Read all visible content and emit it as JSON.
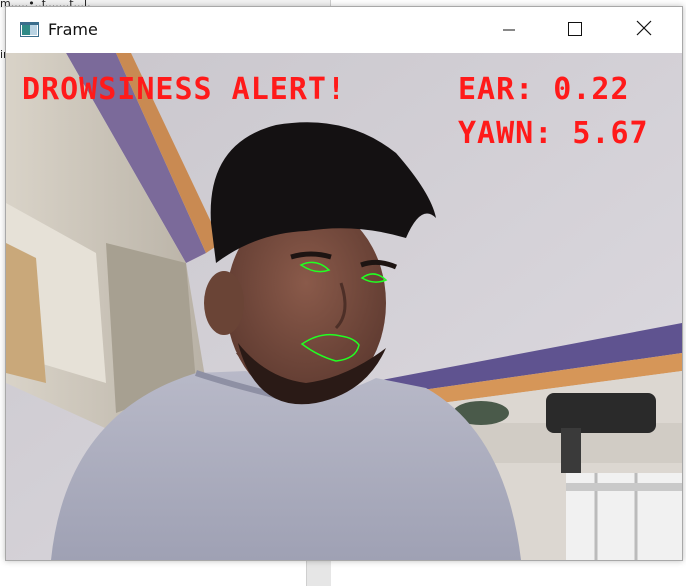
{
  "window": {
    "title": "Frame",
    "icon": "app-window-icon"
  },
  "controls": [
    "minimize-icon",
    "maximize-icon",
    "close-icon"
  ],
  "background_app": {
    "fragment_top": "m.....•..f.......t...l.",
    "fragment_side": "ir"
  },
  "overlay": {
    "alert": "DROWSINESS ALERT!",
    "ear": "EAR: 0.22",
    "yawn": "YAWN: 5.67",
    "text_color": "#ff1a1a",
    "landmark_color": "#22ff22"
  }
}
